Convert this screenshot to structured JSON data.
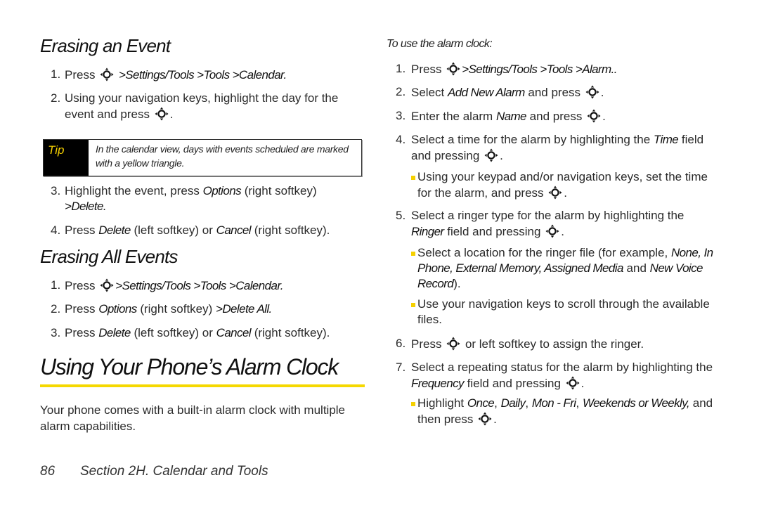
{
  "left": {
    "erasing_event": {
      "title": "Erasing an Event",
      "steps": [
        {
          "num": "1.",
          "pre": "Press",
          "path": ">Settings/Tools >Tools >Calendar."
        },
        {
          "num": "2.",
          "text": "Using your navigation keys, highlight the day for the event and press",
          "post": "."
        },
        {
          "num": "3.",
          "pre": "Highlight the event, press",
          "ui1": "Options",
          "mid": "(right softkey)",
          "path": ">Delete."
        },
        {
          "num": "4.",
          "pre": "Press",
          "ui1": "Delete",
          "mid": "(left softkey) or",
          "ui2": "Cancel",
          "post": "(right softkey)."
        }
      ],
      "tip": {
        "label": "Tip",
        "text": "In the calendar view, days with events scheduled are marked with a yellow triangle."
      }
    },
    "erasing_all": {
      "title": "Erasing All Events",
      "steps": [
        {
          "num": "1.",
          "pre": "Press",
          "path": ">Settings/Tools >Tools >Calendar."
        },
        {
          "num": "2.",
          "pre": "Press",
          "ui1": "Options",
          "mid": "(right softkey)",
          "path": ">Delete All."
        },
        {
          "num": "3.",
          "pre": "Press",
          "ui1": "Delete",
          "mid": "(left softkey) or",
          "ui2": "Cancel",
          "post": "(right softkey)."
        }
      ]
    },
    "alarm_clock": {
      "title": "Using Your Phone’s Alarm Clock",
      "intro": "Your phone comes with a built-in alarm clock with multiple alarm capabilities."
    }
  },
  "right": {
    "subhead": "To use the alarm clock:",
    "steps": [
      {
        "num": "1.",
        "pre": "Press",
        "path": ">Settings/Tools >Tools >Alarm.."
      },
      {
        "num": "2.",
        "pre": "Select",
        "ui1": "Add New Alarm",
        "mid": "and press",
        "post": "."
      },
      {
        "num": "3.",
        "pre": "Enter the alarm",
        "ui1": "Name",
        "mid": "and press",
        "post": "."
      },
      {
        "num": "4.",
        "pre": "Select a time for the alarm by highlighting the",
        "ui1": "Time",
        "mid": "field and pressing",
        "post": "."
      },
      {
        "num": "5.",
        "pre": "Select a ringer type for the alarm by highlighting the",
        "ui1": "Ringer",
        "mid": "field and pressing",
        "post": "."
      },
      {
        "num": "6.",
        "pre": "Press",
        "post": "or left softkey to assign the ringer."
      },
      {
        "num": "7.",
        "pre": "Select a repeating status for the alarm by highlighting the",
        "ui1": "Frequency",
        "mid": "field and pressing",
        "post": "."
      }
    ],
    "bullets": [
      {
        "text": "Using your keypad and/or navigation keys, set the time for the alarm, and press",
        "post": "."
      },
      {
        "pre": "Select a location for the ringer file (for example,",
        "ui1": "None, In Phone, External Memory, Assigned Media",
        "mid": "and",
        "ui2": "New Voice Record",
        "post": ")."
      },
      {
        "text": "Use your navigation keys to scroll through the available files."
      },
      {
        "pre": "Highlight",
        "ui1": "Once",
        "c1": ",",
        "ui2": "Daily",
        "c2": ",",
        "ui3": "Mon - Fri",
        "c3": ",",
        "ui4": "Weekends or Weekly,",
        "mid": "and then press",
        "post": "."
      }
    ]
  },
  "footer": {
    "page_number": "86",
    "section": "Section 2H. Calendar and Tools"
  },
  "icons": {
    "nav_key": "navigation-key-icon",
    "bullet": "yellow-square-bullet"
  },
  "colors": {
    "accent_yellow": "#f5d800",
    "text": "#2a2a2a",
    "tip_bg": "#000000"
  }
}
